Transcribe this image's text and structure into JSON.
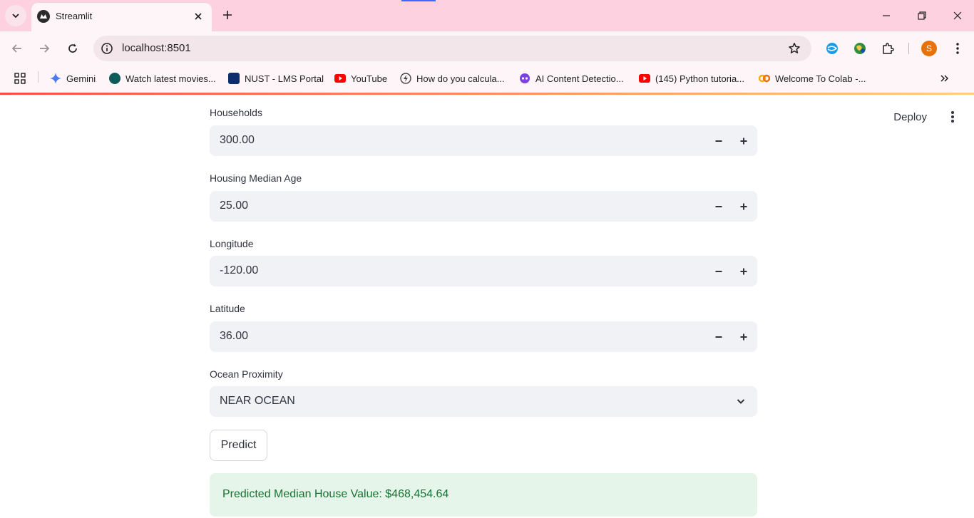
{
  "browser": {
    "tab_title": "Streamlit",
    "url": "localhost:8501",
    "profile_initial": "S",
    "bookmarks": [
      {
        "label": "Gemini",
        "icon": "gemini-icon",
        "color": "#4a7bf7"
      },
      {
        "label": "Watch latest movies...",
        "icon": "movies-icon",
        "color": "#0f5a5a"
      },
      {
        "label": "NUST - LMS Portal",
        "icon": "nust-icon",
        "color": "#0b2d6b"
      },
      {
        "label": "YouTube",
        "icon": "youtube-icon",
        "color": "#ff0000"
      },
      {
        "label": "How do you calcula...",
        "icon": "lightning-icon",
        "color": "#444444"
      },
      {
        "label": "AI Content Detectio...",
        "icon": "ai-detector-icon",
        "color": "#7b3fe4"
      },
      {
        "label": "(145) Python tutoria...",
        "icon": "youtube-icon",
        "color": "#ff0000"
      },
      {
        "label": "Welcome To Colab -...",
        "icon": "colab-icon",
        "color": "#f9ab00"
      }
    ]
  },
  "app": {
    "deploy_label": "Deploy",
    "fields": [
      {
        "label": "Households",
        "value": "300.00"
      },
      {
        "label": "Housing Median Age",
        "value": "25.00"
      },
      {
        "label": "Longitude",
        "value": "-120.00"
      },
      {
        "label": "Latitude",
        "value": "36.00"
      }
    ],
    "ocean": {
      "label": "Ocean Proximity",
      "value": "NEAR OCEAN"
    },
    "predict_label": "Predict",
    "result_text": "Predicted Median House Value: $468,454.64"
  },
  "colors": {
    "tabbar": "#fdd1e0",
    "accent": "#ff4b4b",
    "success_bg": "#e5f5ea",
    "success_text": "#177233"
  }
}
